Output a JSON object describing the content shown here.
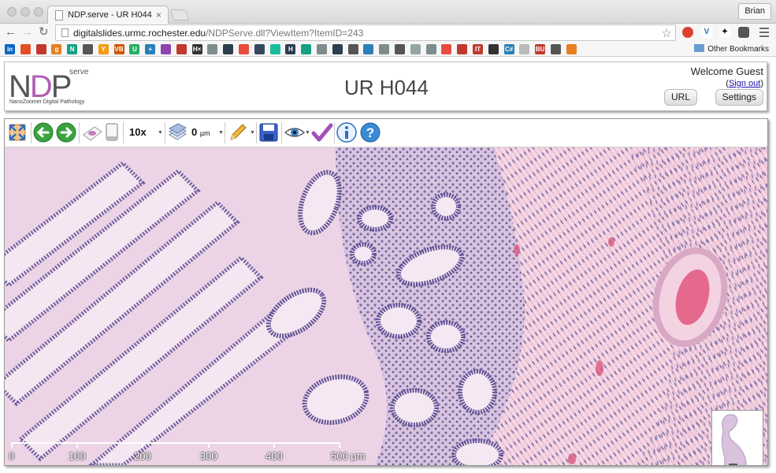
{
  "browser": {
    "tab_title": "NDP.serve - UR H044",
    "tab_close": "×",
    "profile_name": "Brian",
    "url_host": "digitalslides.urmc.rochester.edu",
    "url_path": "/NDPServe.dll?ViewItem?ItemID=243",
    "nav": {
      "back": "←",
      "forward": "→",
      "reload": "↻"
    },
    "star": "☆",
    "other_bookmarks": "Other Bookmarks",
    "bookmark_labels": [
      "in",
      "",
      "",
      "g",
      "N",
      "",
      "Y",
      "VB",
      "U",
      "+",
      "",
      "",
      "H×",
      "",
      "",
      "",
      "",
      "",
      "H",
      "",
      "",
      "",
      "",
      "",
      "",
      "",
      "",
      "",
      "",
      "",
      "IT",
      "",
      "C#",
      "",
      "BU",
      "",
      ""
    ]
  },
  "header": {
    "logo_text_n": "N",
    "logo_text_d": "D",
    "logo_text_p": "P",
    "logo_serve": "serve",
    "logo_tagline": "NanoZoomer Digital Pathology",
    "title": "UR H044",
    "welcome": "Welcome Guest",
    "signout_prefix": "(",
    "signout_link": "Sign out",
    "signout_suffix": ")",
    "url_button": "URL",
    "settings_button": "Settings"
  },
  "viewer_toolbar": {
    "zoom_value": "10x",
    "focus_value": "0",
    "focus_unit": "µm"
  },
  "scale_bar": {
    "ticks": [
      "0",
      "100",
      "200",
      "300",
      "400",
      "500 µm"
    ]
  },
  "colors": {
    "tissue_background": "#f1e3ee",
    "nuclei": "#5c4f8f",
    "stroma": "#e9b9cf",
    "logo_accent": "#b25fb2"
  }
}
